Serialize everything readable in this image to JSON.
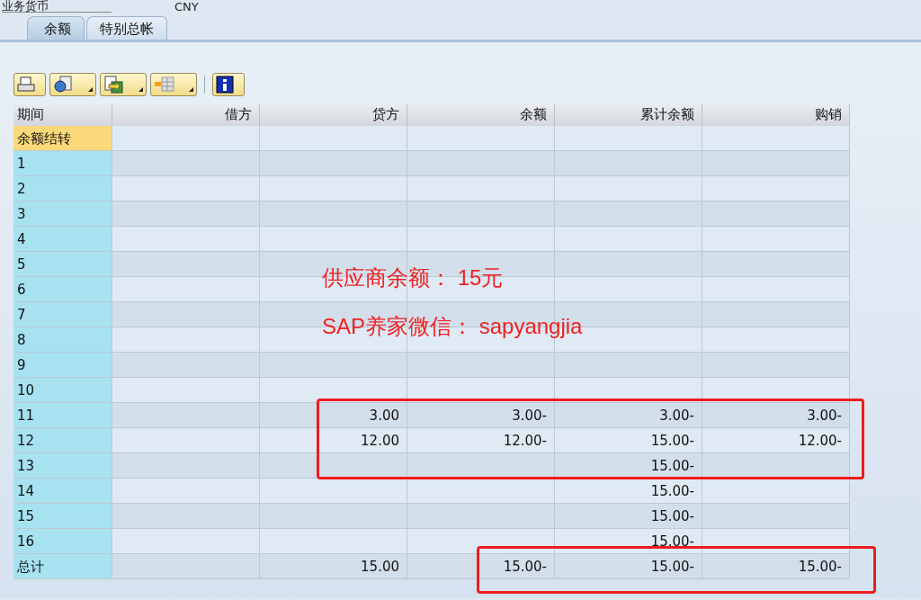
{
  "header_field": {
    "label": "业务货币",
    "value": "CNY"
  },
  "tabs": [
    {
      "label": "余额",
      "selected": true
    },
    {
      "label": "特别总帐",
      "selected": false
    }
  ],
  "toolbar": [
    {
      "kind": "button"
    },
    {
      "kind": "menu"
    },
    {
      "kind": "menu"
    },
    {
      "kind": "menu"
    },
    {
      "kind": "button"
    }
  ],
  "table": {
    "columns": [
      "期间",
      "借方",
      "贷方",
      "余额",
      "累计余额",
      "购销"
    ],
    "rows": [
      {
        "kind": "carryforward",
        "cells": [
          "余额结转",
          "",
          "",
          "",
          "",
          ""
        ]
      },
      {
        "kind": "period",
        "cells": [
          "1",
          "",
          "",
          "",
          "",
          ""
        ]
      },
      {
        "kind": "period",
        "cells": [
          "2",
          "",
          "",
          "",
          "",
          ""
        ]
      },
      {
        "kind": "period",
        "cells": [
          "3",
          "",
          "",
          "",
          "",
          ""
        ]
      },
      {
        "kind": "period",
        "cells": [
          "4",
          "",
          "",
          "",
          "",
          ""
        ]
      },
      {
        "kind": "period",
        "cells": [
          "5",
          "",
          "",
          "",
          "",
          ""
        ]
      },
      {
        "kind": "period",
        "cells": [
          "6",
          "",
          "",
          "",
          "",
          ""
        ]
      },
      {
        "kind": "period",
        "cells": [
          "7",
          "",
          "",
          "",
          "",
          ""
        ]
      },
      {
        "kind": "period",
        "cells": [
          "8",
          "",
          "",
          "",
          "",
          ""
        ]
      },
      {
        "kind": "period",
        "cells": [
          "9",
          "",
          "",
          "",
          "",
          ""
        ]
      },
      {
        "kind": "period",
        "cells": [
          "10",
          "",
          "",
          "",
          "",
          ""
        ]
      },
      {
        "kind": "period",
        "cells": [
          "11",
          "",
          "3.00",
          "3.00-",
          "3.00-",
          "3.00-"
        ]
      },
      {
        "kind": "period",
        "cells": [
          "12",
          "",
          "12.00",
          "12.00-",
          "15.00-",
          "12.00-"
        ]
      },
      {
        "kind": "period",
        "cells": [
          "13",
          "",
          "",
          "",
          "15.00-",
          ""
        ]
      },
      {
        "kind": "period",
        "cells": [
          "14",
          "",
          "",
          "",
          "15.00-",
          ""
        ]
      },
      {
        "kind": "period",
        "cells": [
          "15",
          "",
          "",
          "",
          "15.00-",
          ""
        ]
      },
      {
        "kind": "period",
        "cells": [
          "16",
          "",
          "",
          "",
          "15.00-",
          ""
        ]
      },
      {
        "kind": "total",
        "cells": [
          "总计",
          "",
          "15.00",
          "15.00-",
          "15.00-",
          "15.00-"
        ]
      }
    ]
  },
  "annotations": [
    {
      "text": "供应商余额： 15元"
    },
    {
      "text": "SAP养家微信： sapyangjia"
    }
  ]
}
